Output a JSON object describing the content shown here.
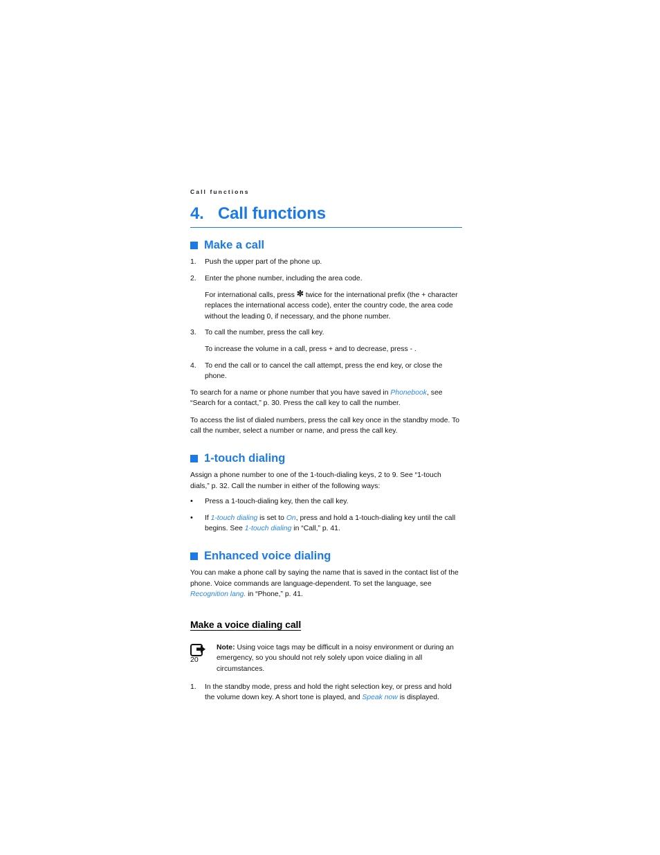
{
  "colors": {
    "accent": "#1b7ae8",
    "inline_link": "#2a86ee",
    "text": "#111111"
  },
  "running_header": "Call functions",
  "chapter": {
    "number": "4.",
    "title": "Call functions"
  },
  "sections": [
    {
      "id": "make-a-call",
      "heading": "Make a call",
      "items": [
        {
          "marker": "1.",
          "text": "Push the upper part of the phone up."
        },
        {
          "marker": "2.",
          "text": "Enter the phone number, including the area code."
        }
      ],
      "continuation_1_pre": "For international calls, press ",
      "continuation_1_asterisk": "✼",
      "continuation_1_post": " twice for the international prefix (the + character replaces the international access code), enter the country code, the area code without the leading 0, if necessary, and the phone number.",
      "item_3_marker": "3.",
      "item_3_text": "To call the number, press the call key.",
      "continuation_2": "To increase the volume in a call, press + and to decrease, press - .",
      "item_4_marker": "4.",
      "item_4_text": "To end the call or to cancel the call attempt, press the end key, or close the phone.",
      "para_1_pre": "To search for a name or phone number that you have saved in ",
      "para_1_ui": "Phonebook",
      "para_1_post": ", see “Search for a contact,” p. 30. Press the call key to call the number.",
      "para_2": "To access the list of dialed numbers, press the call key once in the standby mode. To call the number, select a number or name, and press the call key."
    },
    {
      "id": "one-touch-dialing",
      "heading": "1-touch dialing",
      "intro": "Assign a phone number to one of the 1-touch-dialing keys, 2 to 9. See “1-touch dials,” p. 32. Call the number in either of the following ways:",
      "bullet_marker": "•",
      "bullet_1": "Press a 1-touch-dialing key, then the call key.",
      "bullet_2_pre": "If ",
      "bullet_2_ui_a": "1-touch dialing",
      "bullet_2_mid": " is set to ",
      "bullet_2_ui_b": "On",
      "bullet_2_mid2": ", press and hold a 1-touch-dialing key until the call begins. See ",
      "bullet_2_ui_c": "1-touch dialing",
      "bullet_2_post": " in “Call,” p. 41."
    },
    {
      "id": "enhanced-voice-dialing",
      "heading": "Enhanced voice dialing",
      "intro_pre": "You can make a phone call by saying the name that is saved in the contact list of the phone. Voice commands are language-dependent. To set the language, see ",
      "intro_ui": "Recognition lang.",
      "intro_post": " in “Phone,” p. 41.",
      "sub_heading": "Make a voice dialing call",
      "note_icon": "note-arrow-icon",
      "note_label": "Note:",
      "note_text": " Using voice tags may be difficult in a noisy environment or during an emergency, so you should not rely solely upon voice dialing in all circumstances.",
      "step_marker": "1.",
      "step_pre": "In the standby mode, press and hold the right selection key, or press and hold the volume down key. A short tone is played, and ",
      "step_ui": "Speak now",
      "step_post": " is displayed."
    }
  ],
  "page_number": "20"
}
